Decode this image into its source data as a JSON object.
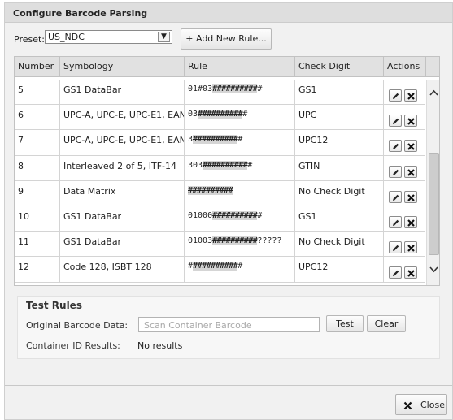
{
  "dialog": {
    "title": "Configure Barcode Parsing"
  },
  "preset": {
    "label": "Preset:",
    "value": "US_NDC"
  },
  "toolbar": {
    "add_rule_label": "+ Add New Rule..."
  },
  "table": {
    "columns": [
      "Number",
      "Symbology",
      "Rule",
      "Check Digit",
      "Actions"
    ],
    "rows": [
      {
        "number": "5",
        "symbology": "GS1 DataBar",
        "rule_prefix": "01#03",
        "rule_hash": "##########",
        "rule_suffix": "#",
        "check_digit": "GS1"
      },
      {
        "number": "6",
        "symbology": "UPC-A, UPC-E, UPC-E1, EAN-8",
        "rule_prefix": "03",
        "rule_hash": "##########",
        "rule_suffix": "#",
        "check_digit": "UPC"
      },
      {
        "number": "7",
        "symbology": "UPC-A, UPC-E, UPC-E1, EAN-8",
        "rule_prefix": "3",
        "rule_hash": "##########",
        "rule_suffix": "#",
        "check_digit": "UPC12"
      },
      {
        "number": "8",
        "symbology": "Interleaved 2 of 5, ITF-14",
        "rule_prefix": "303",
        "rule_hash": "##########",
        "rule_suffix": "#",
        "check_digit": "GTIN"
      },
      {
        "number": "9",
        "symbology": "Data Matrix",
        "rule_prefix": "",
        "rule_hash": "##########",
        "rule_suffix": "",
        "check_digit": "No Check Digit"
      },
      {
        "number": "10",
        "symbology": "GS1 DataBar",
        "rule_prefix": "01000",
        "rule_hash": "##########",
        "rule_suffix": "#",
        "check_digit": "GS1"
      },
      {
        "number": "11",
        "symbology": "GS1 DataBar",
        "rule_prefix": "01003",
        "rule_hash": "##########",
        "rule_suffix": "?????",
        "check_digit": "No Check Digit"
      },
      {
        "number": "12",
        "symbology": "Code 128, ISBT 128",
        "rule_prefix": "#",
        "rule_hash": "##########",
        "rule_suffix": "#",
        "check_digit": "UPC12"
      }
    ]
  },
  "test_rules": {
    "title": "Test Rules",
    "original_label": "Original Barcode Data:",
    "input_placeholder": "Scan Container Barcode",
    "test_label": "Test",
    "clear_label": "Clear",
    "results_label": "Container ID Results:",
    "results_value": "No results"
  },
  "footer": {
    "close_label": "Close"
  },
  "icons": {
    "edit": "pencil-icon",
    "delete": "x-icon",
    "dropdown": "chevron-down-icon",
    "scroll_up": "chevron-up-icon",
    "scroll_down": "chevron-down-icon",
    "close": "x-icon"
  },
  "colors": {
    "header_bg": "#dedede",
    "table_header_bg": "#e1e1e1",
    "hash_bg": "#d5d5d5"
  }
}
